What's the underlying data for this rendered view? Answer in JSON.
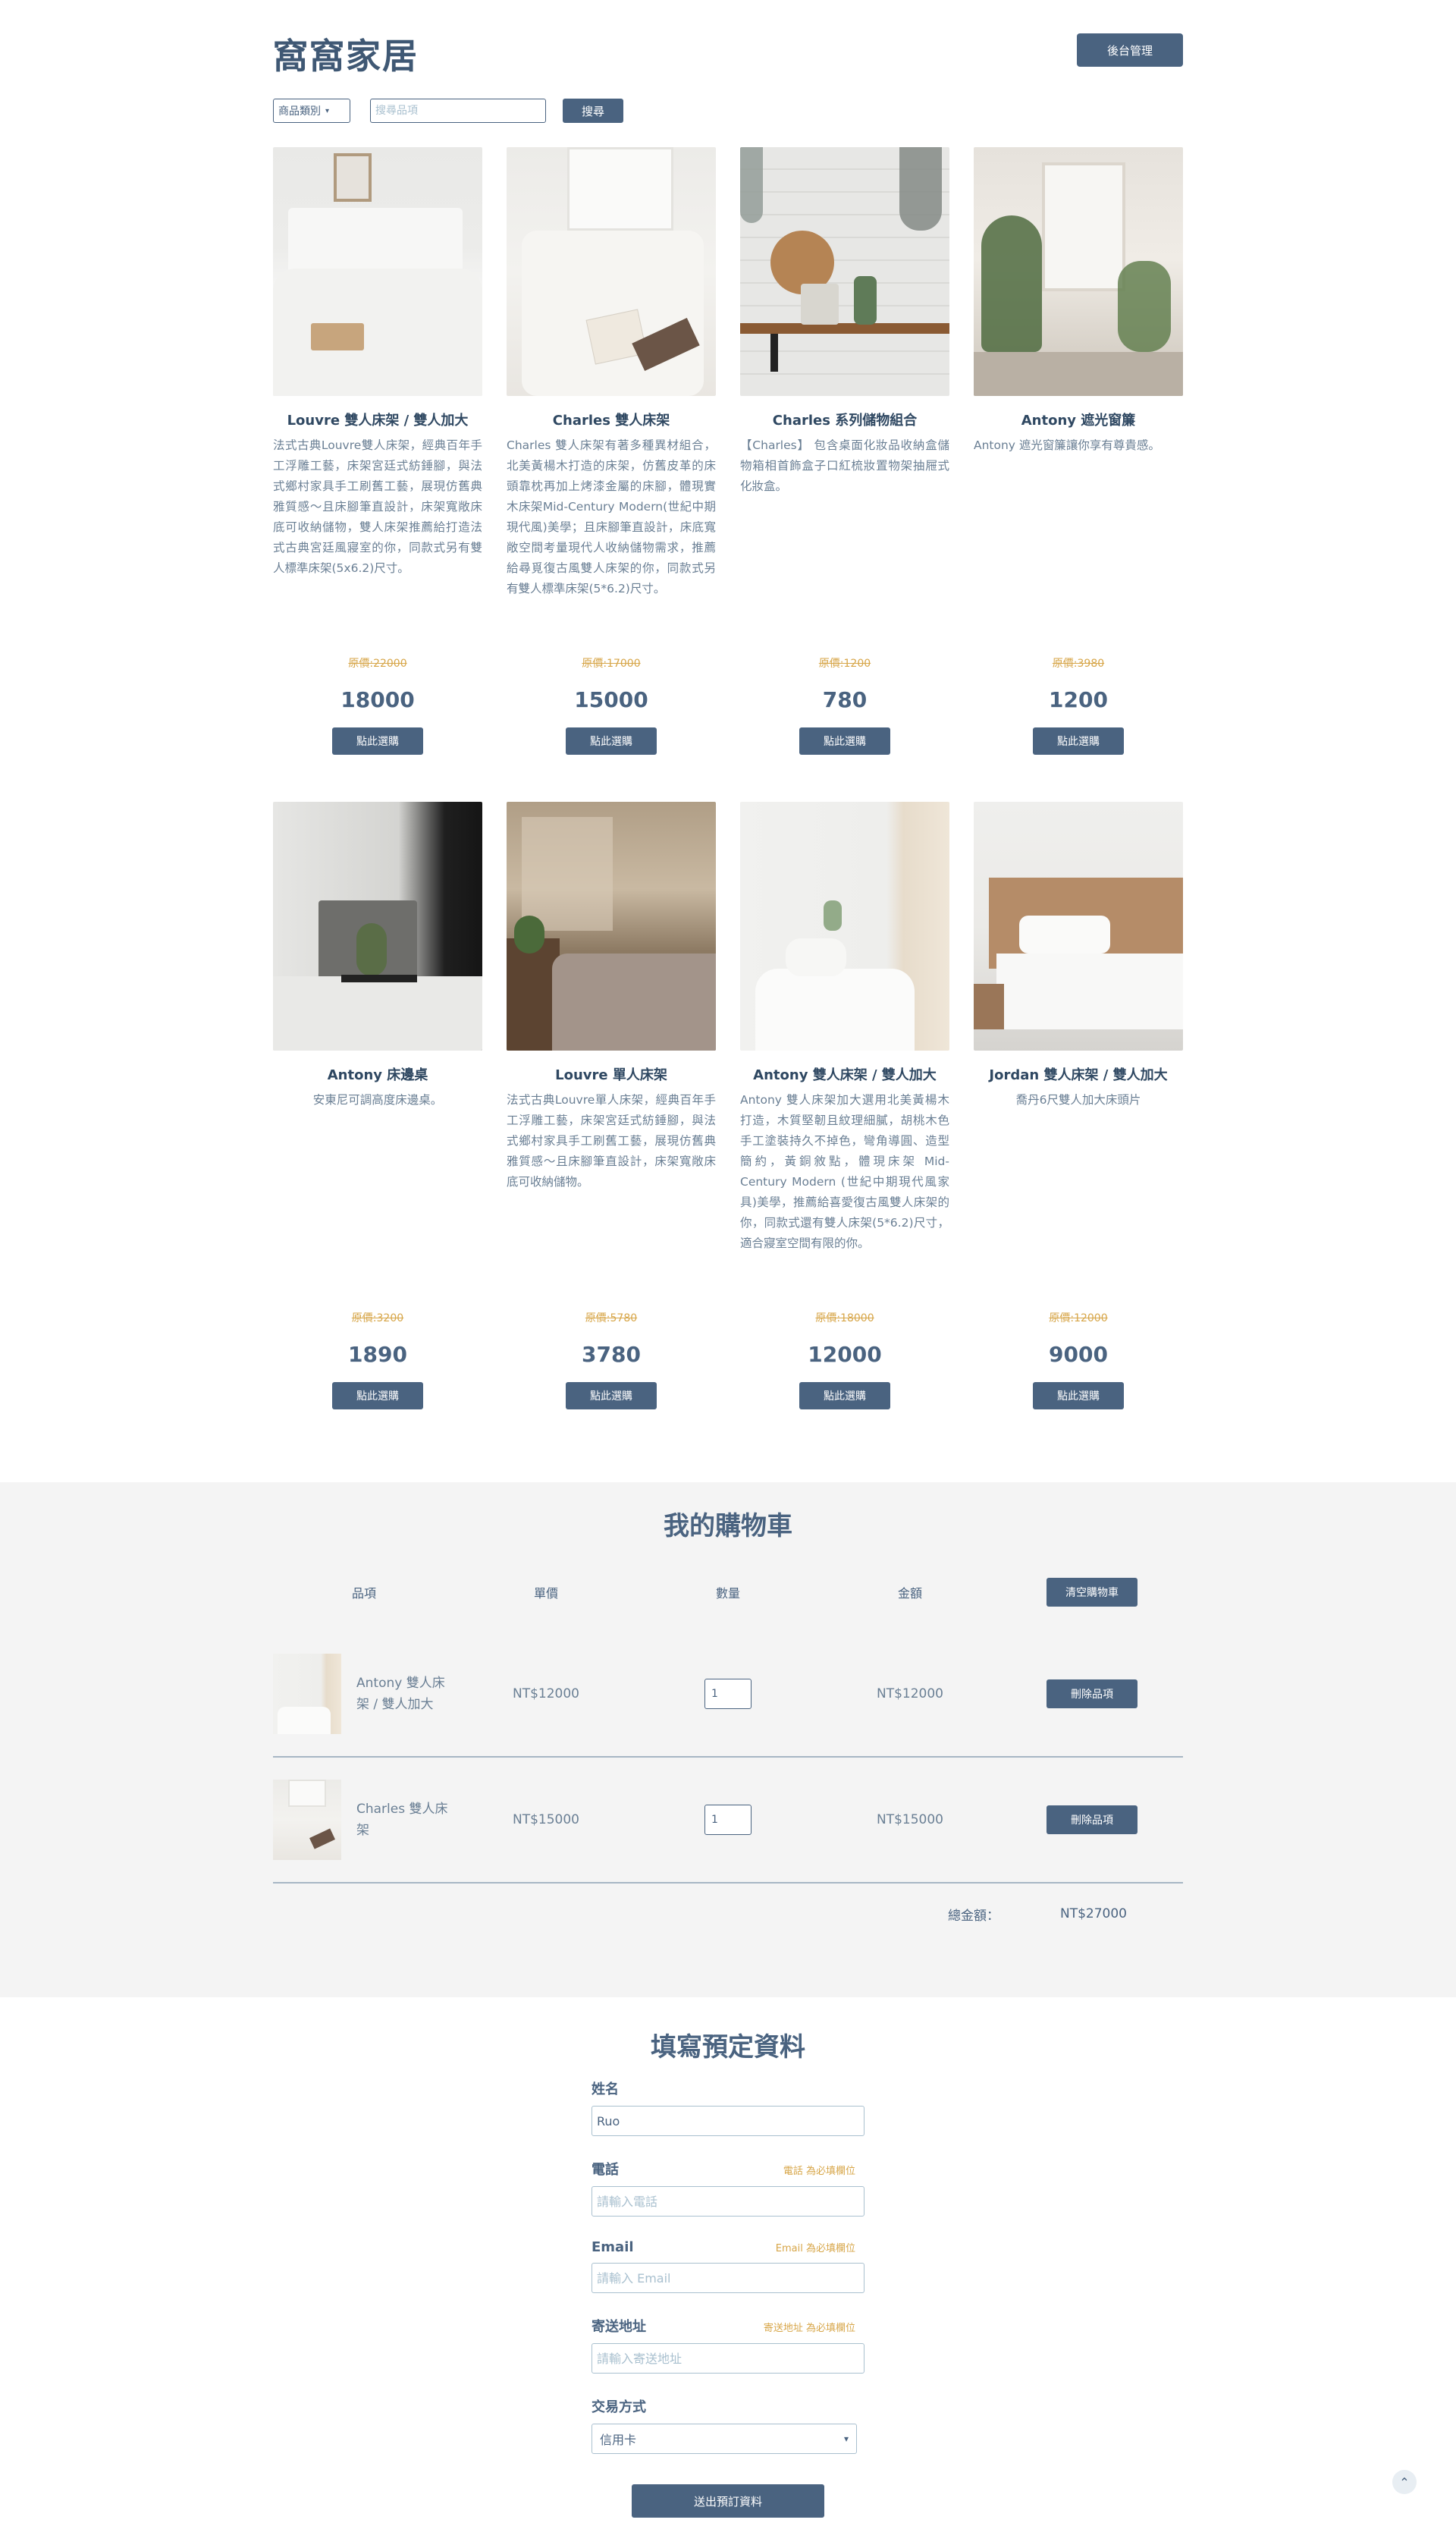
{
  "brand": "窩窩家居",
  "admin_label": "後台管理",
  "filters": {
    "category_label": "商品類別",
    "search_placeholder": "搜尋品項",
    "search_button": "搜尋"
  },
  "products": [
    {
      "title": "Louvre 雙人床架 / 雙人加大",
      "desc": "法式古典Louvre雙人床架，經典百年手工浮雕工藝，床架宮廷式紡錘腳，與法式鄉村家具手工刷舊工藝，展現仿舊典雅質感～且床腳筆直設計，床架寬敞床底可收納儲物，雙人床架推薦給打造法式古典宮廷風寢室的你，同款式另有雙人標準床架(5x6.2)尺寸。",
      "origin": "原價:22000",
      "price": "18000",
      "button": "點此選購"
    },
    {
      "title": "Charles 雙人床架",
      "desc": "Charles 雙人床架有著多種異材組合，北美黃楊木打造的床架，仿舊皮革的床頭靠枕再加上烤漆金屬的床腳，體現實木床架Mid-Century Modern(世紀中期現代風)美學；且床腳筆直設計，床底寬敞空間考量現代人收納儲物需求，推薦給尋覓復古風雙人床架的你，同款式另有雙人標準床架(5*6.2)尺寸。",
      "origin": "原價:17000",
      "price": "15000",
      "button": "點此選購"
    },
    {
      "title": "Charles 系列儲物組合",
      "desc": "【Charles】 包含桌面化妝品收納盒儲物箱相首飾盒子口紅梳妝置物架抽屜式化妝盒。",
      "origin": "原價:1200",
      "price": "780",
      "button": "點此選購"
    },
    {
      "title": "Antony 遮光窗簾",
      "desc": "Antony 遮光窗簾讓你享有尊貴感。",
      "origin": "原價:3980",
      "price": "1200",
      "button": "點此選購"
    },
    {
      "title": "Antony 床邊桌",
      "desc": "安東尼可調高度床邊桌。",
      "origin": "原價:3200",
      "price": "1890",
      "button": "點此選購"
    },
    {
      "title": "Louvre 單人床架",
      "desc": "法式古典Louvre單人床架，經典百年手工浮雕工藝，床架宮廷式紡錘腳，與法式鄉村家具手工刷舊工藝，展現仿舊典雅質感～且床腳筆直設計，床架寬敞床底可收納儲物。",
      "origin": "原價:5780",
      "price": "3780",
      "button": "點此選購"
    },
    {
      "title": "Antony 雙人床架 / 雙人加大",
      "desc": "Antony 雙人床架加大選用北美黃楊木打造，木質堅韌且紋理細膩，胡桃木色手工塗裝持久不掉色，彎角導圓、造型簡約，黃銅敘點，體現床架 Mid-Century Modern (世紀中期現代風家具)美學，推薦給喜愛復古風雙人床架的你，同款式還有雙人床架(5*6.2)尺寸，適合寢室空間有限的你。",
      "origin": "原價:18000",
      "price": "12000",
      "button": "點此選購"
    },
    {
      "title": "Jordan 雙人床架 / 雙人加大",
      "desc": "喬丹6尺雙人加大床頭片",
      "origin": "原價:12000",
      "price": "9000",
      "button": "點此選購"
    }
  ],
  "cart": {
    "title": "我的購物車",
    "headers": [
      "品項",
      "單價",
      "數量",
      "金額"
    ],
    "clear_button": "清空購物車",
    "items": [
      {
        "name": "Antony 雙人床架 / 雙人加大",
        "unit_price": "NT$12000",
        "qty": "1",
        "amount": "NT$12000",
        "remove": "刪除品項"
      },
      {
        "name": "Charles 雙人床架",
        "unit_price": "NT$15000",
        "qty": "1",
        "amount": "NT$15000",
        "remove": "刪除品項"
      }
    ],
    "total_label": "總金額：",
    "total_value": "NT$27000"
  },
  "form": {
    "title": "填寫預定資料",
    "name_label": "姓名",
    "name_value": "Ruo",
    "phone_label": "電話",
    "phone_warn": "電話 為必填欄位",
    "phone_placeholder": "請輸入電話",
    "email_label": "Email",
    "email_warn": "Email 為必填欄位",
    "email_placeholder": "請輸入 Email",
    "address_label": "寄送地址",
    "address_warn": "寄送地址 為必填欄位",
    "address_placeholder": "請輸入寄送地址",
    "payment_label": "交易方式",
    "payment_value": "信用卡",
    "submit": "送出預訂資料"
  },
  "colors": {
    "primary": "#4a6380",
    "warn": "#d7a649",
    "cart_bg": "#f4f4f4"
  },
  "icons": {
    "select_arrow": "chevron-down-icon",
    "back_to_top": "chevron-up-icon"
  }
}
